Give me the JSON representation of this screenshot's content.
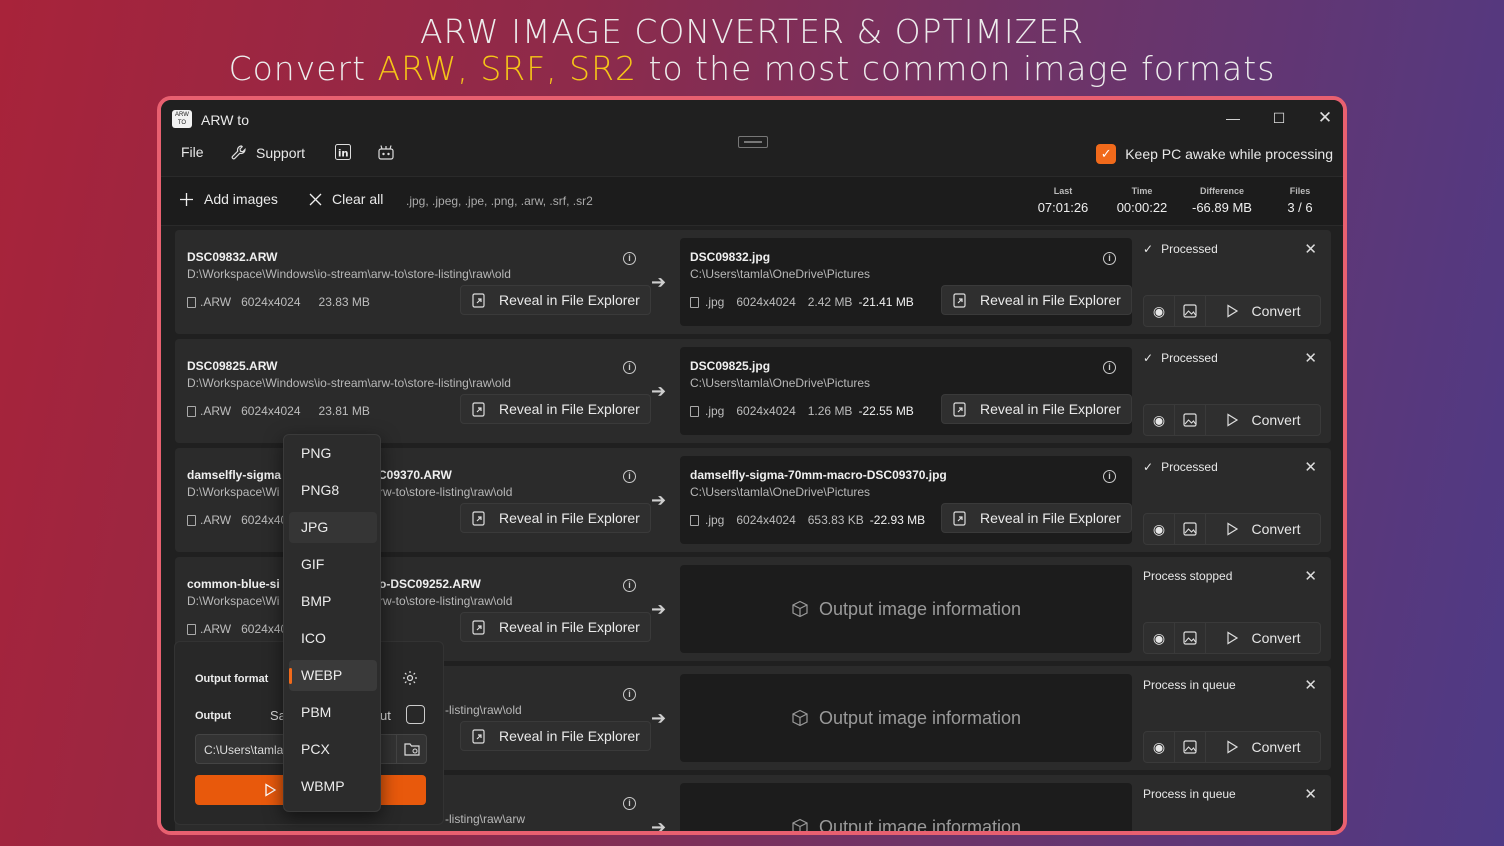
{
  "hero": {
    "line1": "ARW IMAGE CONVERTER & OPTIMIZER",
    "line2_prefix": "Convert ",
    "line2_highlight": "ARW, SRF, SR2",
    "line2_suffix": " to the most common image formats"
  },
  "window": {
    "title": "ARW to",
    "icon_text": "ARW\nTO"
  },
  "menu": {
    "file": "File",
    "support": "Support",
    "keep_awake": "Keep PC awake while processing",
    "keep_awake_checked": true
  },
  "toolbar": {
    "add_images": "Add images",
    "clear_all": "Clear all",
    "extensions": ".jpg, .jpeg, .jpe, .png, .arw, .srf, .sr2",
    "stats": [
      {
        "label": "Last",
        "value": "07:01:26"
      },
      {
        "label": "Time",
        "value": "00:00:22"
      },
      {
        "label": "Difference",
        "value": "-66.89 MB"
      },
      {
        "label": "Files",
        "value": "3 / 6"
      }
    ]
  },
  "reveal_label": "Reveal in File Explorer",
  "convert_label": "Convert",
  "empty_output_label": "Output image information",
  "rows": [
    {
      "in_name": "DSC09832.ARW",
      "in_path": "D:\\Workspace\\Windows\\io-stream\\arw-to\\store-listing\\raw\\old",
      "in_ext": ".ARW",
      "in_dim": "6024x4024",
      "in_size": "23.83 MB",
      "out_name": "DSC09832.jpg",
      "out_path": "C:\\Users\\tamla\\OneDrive\\Pictures",
      "out_ext": ".jpg",
      "out_dim": "6024x4024",
      "out_size": "2.42 MB",
      "out_diff": "-21.41 MB",
      "status": "Processed"
    },
    {
      "in_name": "DSC09825.ARW",
      "in_path": "D:\\Workspace\\Windows\\io-stream\\arw-to\\store-listing\\raw\\old",
      "in_ext": ".ARW",
      "in_dim": "6024x4024",
      "in_size": "23.81 MB",
      "out_name": "DSC09825.jpg",
      "out_path": "C:\\Users\\tamla\\OneDrive\\Pictures",
      "out_ext": ".jpg",
      "out_dim": "6024x4024",
      "out_size": "1.26 MB",
      "out_diff": "-22.55 MB",
      "status": "Processed"
    },
    {
      "in_name_a": "damselfly-sigma",
      "in_name_b": "C09370.ARW",
      "in_path_a": "D:\\Workspace\\Wi",
      "in_path_b": "rw-to\\store-listing\\raw\\old",
      "in_ext": ".ARW",
      "in_dim_a": "6024x40",
      "out_name": "damselfly-sigma-70mm-macro-DSC09370.jpg",
      "out_path": "C:\\Users\\tamla\\OneDrive\\Pictures",
      "out_ext": ".jpg",
      "out_dim": "6024x4024",
      "out_size": "653.83 KB",
      "out_diff": "-22.93 MB",
      "status": "Processed"
    },
    {
      "in_name_a": "common-blue-si",
      "in_name_b": "o-DSC09252.ARW",
      "in_path_a": "D:\\Workspace\\Wi",
      "in_path_b": "rw-to\\store-listing\\raw\\old",
      "in_ext": ".ARW",
      "in_dim_a": "6024x40",
      "status": "Process stopped"
    },
    {
      "in_path_b": "-listing\\raw\\old",
      "status": "Process in queue"
    },
    {
      "in_path_b": "-listing\\raw\\arw",
      "status": "Process in queue"
    }
  ],
  "output_panel": {
    "format_label": "Output format",
    "output_label": "Output",
    "output_mode_partial": "Sa",
    "output_suffix_partial": "ut",
    "path_value": "C:\\Users\\tamla\\"
  },
  "format_options": [
    "PNG",
    "PNG8",
    "JPG",
    "GIF",
    "BMP",
    "ICO",
    "WEBP",
    "PBM",
    "PCX",
    "WBMP"
  ],
  "format_hovered": "JPG",
  "format_selected": "WEBP",
  "colors": {
    "accent": "#f16a1b",
    "frame": "#e86070",
    "highlight": "#f5c518"
  }
}
